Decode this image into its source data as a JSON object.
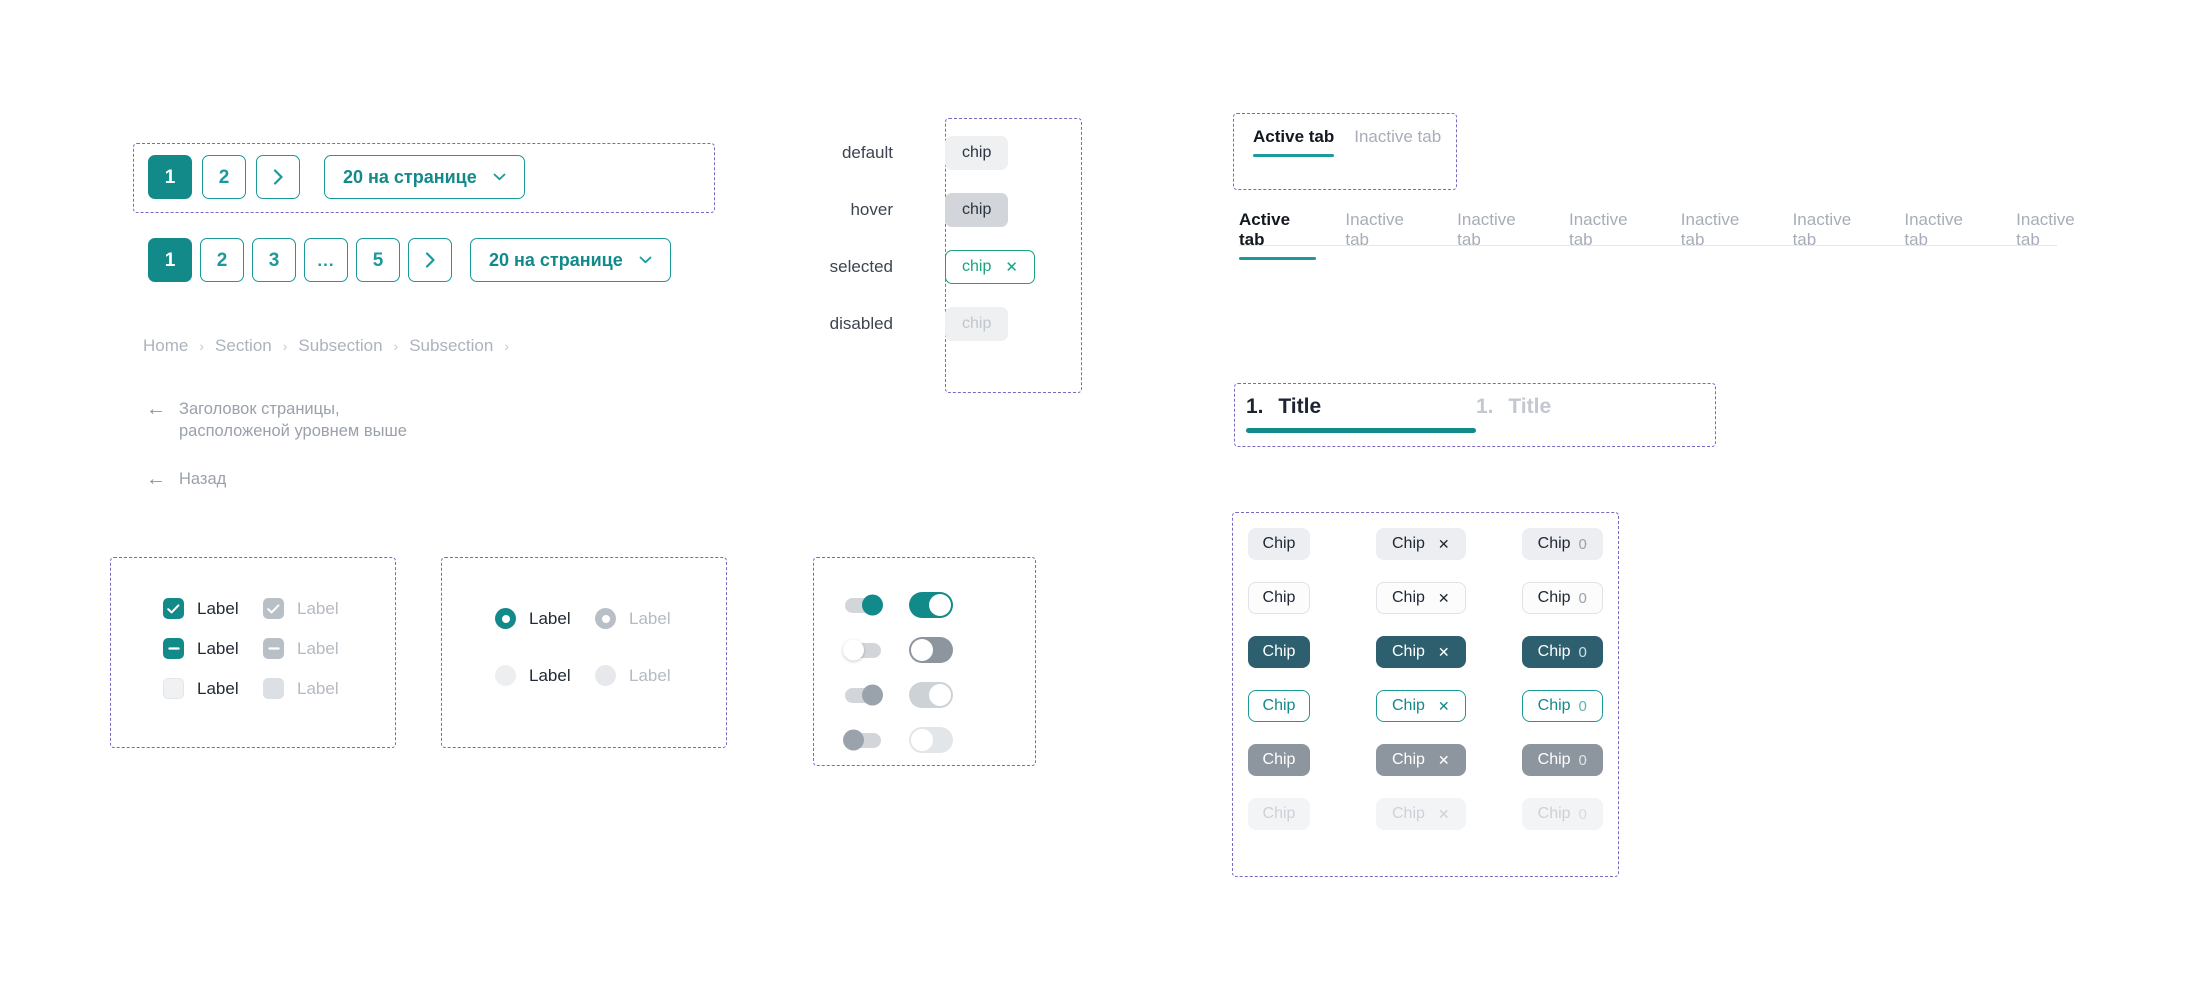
{
  "colors": {
    "accent_teal": "#138a8a",
    "accent_teal_light": "#1a9a9a",
    "chip_dark": "#2d5f6e",
    "chip_gray": "#8d959e",
    "annotation_purple": "#7b68c4",
    "text_dark": "#1b2430",
    "text_muted": "#a7adb7"
  },
  "pagination_small": {
    "pages": [
      "1",
      "2"
    ],
    "next_icon": "chevron-right-icon",
    "per_page_label": "20 на странице",
    "chevron_icon": "chevron-down-icon"
  },
  "pagination_large": {
    "pages": [
      "1",
      "2",
      "3",
      "...",
      "5"
    ],
    "next_icon": "chevron-right-icon",
    "per_page_label": "20 на странице",
    "chevron_icon": "chevron-down-icon"
  },
  "breadcrumbs": {
    "items": [
      "Home",
      "Section",
      "Subsection",
      "Subsection"
    ],
    "separator": "›"
  },
  "back_links": [
    {
      "arrow": "←",
      "label": "Заголовок страницы, расположеной уровнем выше"
    },
    {
      "arrow": "←",
      "label": "Назад"
    }
  ],
  "chip_states": {
    "rows": [
      {
        "state": "default",
        "label": "chip",
        "close": false
      },
      {
        "state": "hover",
        "label": "chip",
        "close": false
      },
      {
        "state": "selected",
        "label": "chip",
        "close": true,
        "close_icon": "✕"
      },
      {
        "state": "disabled",
        "label": "chip",
        "close": false
      }
    ]
  },
  "tabs_boxed": {
    "items": [
      {
        "label": "Active tab",
        "active": true
      },
      {
        "label": "Inactive tab",
        "active": false
      }
    ]
  },
  "tabs_strip": {
    "items": [
      {
        "label": "Active tab",
        "active": true
      },
      {
        "label": "Inactive tab",
        "active": false
      },
      {
        "label": "Inactive tab",
        "active": false
      },
      {
        "label": "Inactive tab",
        "active": false
      },
      {
        "label": "Inactive tab",
        "active": false
      },
      {
        "label": "Inactive tab",
        "active": false
      },
      {
        "label": "Inactive tab",
        "active": false
      },
      {
        "label": "Inactive tab",
        "active": false
      }
    ]
  },
  "step_tabs": {
    "items": [
      {
        "number": "1.",
        "label": "Title",
        "active": true
      },
      {
        "number": "1.",
        "label": "Title",
        "active": false
      }
    ]
  },
  "checkboxes": {
    "rows": [
      {
        "state": "checked",
        "enabled_label": "Label",
        "disabled_label": "Label"
      },
      {
        "state": "indeterminate",
        "enabled_label": "Label",
        "disabled_label": "Label"
      },
      {
        "state": "unchecked",
        "enabled_label": "Label",
        "disabled_label": "Label"
      }
    ]
  },
  "radios": {
    "rows": [
      {
        "state": "selected",
        "enabled_label": "Label",
        "disabled_label": "Label"
      },
      {
        "state": "unselected",
        "enabled_label": "Label",
        "disabled_label": "Label"
      }
    ]
  },
  "toggles": {
    "rows": [
      {
        "state": "on",
        "small_on": true,
        "large_on": true
      },
      {
        "state": "off",
        "small_on": false,
        "large_on": false
      },
      {
        "state": "on-disabled",
        "small_on": true,
        "large_on": true
      },
      {
        "state": "off-disabled",
        "small_on": false,
        "large_on": false
      }
    ]
  },
  "chip_matrix": {
    "label": "Chip",
    "count": "0",
    "close_icon": "✕",
    "variants": [
      {
        "style": "fill-light"
      },
      {
        "style": "out-light"
      },
      {
        "style": "fill-dark"
      },
      {
        "style": "out-teal"
      },
      {
        "style": "fill-gray"
      },
      {
        "style": "disabled"
      }
    ],
    "columns": [
      "plain",
      "closable",
      "counted"
    ]
  }
}
